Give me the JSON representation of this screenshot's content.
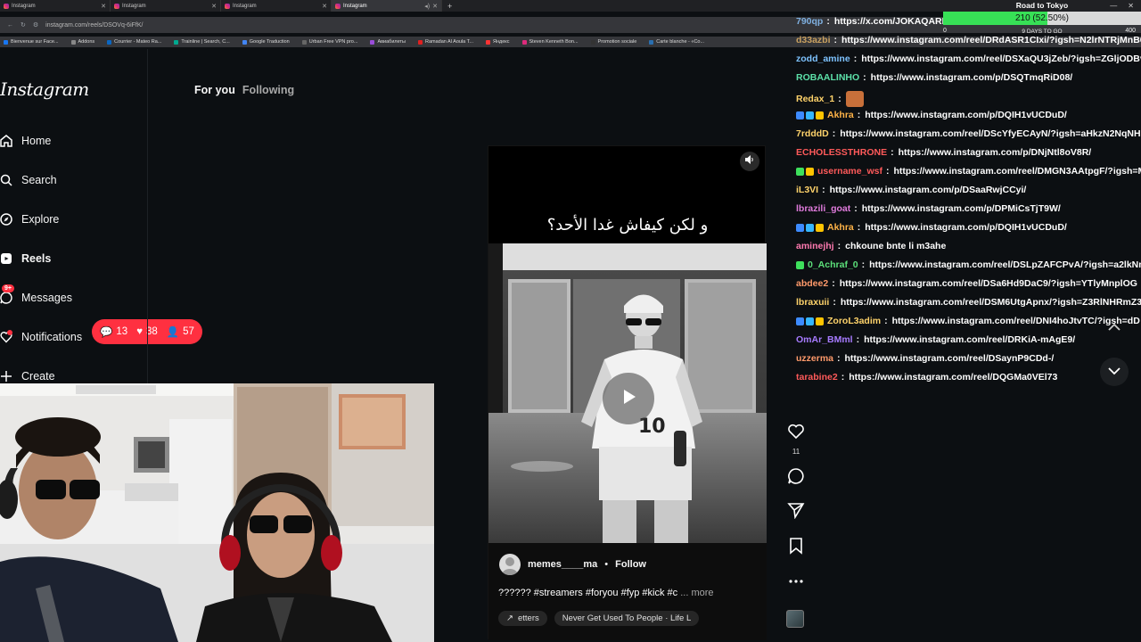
{
  "browser": {
    "tabs": [
      {
        "title": "Instagram",
        "active": false
      },
      {
        "title": "Instagram",
        "active": false
      },
      {
        "title": "Instagram",
        "active": false
      },
      {
        "title": "Instagram",
        "active": true
      }
    ],
    "new_tab": "+",
    "url": "instagram.com/reels/DSOVq-6iFfK/",
    "bookmarks": [
      {
        "label": "Bienvenue sur Face...",
        "color": "#1877f2"
      },
      {
        "label": "Addons",
        "color": "#888888"
      },
      {
        "label": "Courrier - Mateo Ra...",
        "color": "#0a66c2"
      },
      {
        "label": "Trainline | Search, C...",
        "color": "#00a88f"
      },
      {
        "label": "Google Traduction",
        "color": "#4285f4"
      },
      {
        "label": "Urban Free VPN pro...",
        "color": "#666666"
      },
      {
        "label": "Авиабилеты",
        "color": "#9a4dd9"
      },
      {
        "label": "Ramadan Al Aoula T...",
        "color": "#e02020"
      },
      {
        "label": "Яндекс",
        "color": "#ff3333"
      },
      {
        "label": "Steven Kenneth Bon...",
        "color": "#dd2a7b"
      },
      {
        "label": "Promotion sociale",
        "color": "#333333"
      },
      {
        "label": "Carte blanche - «Co...",
        "color": "#2a6fb0"
      }
    ]
  },
  "instagram": {
    "logo": "Instagram",
    "nav": {
      "home": "Home",
      "search": "Search",
      "explore": "Explore",
      "reels": "Reels",
      "messages": "Messages",
      "messages_badge": "9+",
      "notifications": "Notifications",
      "create": "Create"
    },
    "notif_pill": {
      "comments": "13",
      "likes": "38",
      "follows": "57"
    },
    "feed_tabs": {
      "for_you": "For you",
      "following": "Following"
    },
    "reel": {
      "caption_overlay": "و لكن كيفاش غدا الأحد؟",
      "author": "memes____ma",
      "separator": "•",
      "follow": "Follow",
      "caption": "?????? #streamers #foryou #fyp #kick #c",
      "more": "... more",
      "audio_left": "etters",
      "audio_track": "Never Get Used To People · Life L",
      "likes_count": "11"
    }
  },
  "chat": {
    "messages": [
      {
        "user": "790qp",
        "color": "#7fb0e0",
        "text": "https://x.com/JOKAQARM...",
        "icons": []
      },
      {
        "user": "d33azbi",
        "color": "#c8a060",
        "text": "https://www.instagram.com/reel/DRdASR1CIxi/?igsh=N2lrNTRjMnB6",
        "icons": []
      },
      {
        "user": "zodd_amine",
        "color": "#7ec3ff",
        "text": "https://www.instagram.com/reel/DSXaQU3jZeb/?igsh=ZGljODBv",
        "icons": []
      },
      {
        "user": "ROBAALINHO",
        "color": "#5ce0a8",
        "text": "https://www.instagram.com/p/DSQTmqRiD08/",
        "icons": []
      },
      {
        "user": "Redax_1",
        "color": "#ffd36b",
        "text": "",
        "icons": [],
        "emote": true
      },
      {
        "user": "Akhra",
        "color": "#ffb347",
        "text": "https://www.instagram.com/p/DQIH1vUCDuD/",
        "icons": [
          "#3d8bff",
          "#36b6ff",
          "#ffc400"
        ]
      },
      {
        "user": "7rdddD",
        "color": "#ffd36b",
        "text": "https://www.instagram.com/reel/DScYfyECAyN/?igsh=aHkzN2NqNH",
        "icons": []
      },
      {
        "user": "ECHOLESSTHRONE",
        "color": "#ff5a5a",
        "text": "https://www.instagram.com/p/DNjNtl8oV8R/",
        "icons": []
      },
      {
        "user": "username_wsf",
        "color": "#ff5a5a",
        "text": "https://www.instagram.com/reel/DMGN3AAtpgF/?igsh=M",
        "icons": [
          "#3ee05c",
          "#ffc400"
        ]
      },
      {
        "user": "iL3VI",
        "color": "#ffd36b",
        "text": "https://www.instagram.com/p/DSaaRwjCCyi/",
        "icons": []
      },
      {
        "user": "lbrazili_goat",
        "color": "#e07bdc",
        "text": "https://www.instagram.com/p/DPMiCsTjT9W/",
        "icons": []
      },
      {
        "user": "Akhra",
        "color": "#ffb347",
        "text": "https://www.instagram.com/p/DQIH1vUCDuD/",
        "icons": [
          "#3d8bff",
          "#36b6ff",
          "#ffc400"
        ]
      },
      {
        "user": "aminejhj",
        "color": "#ff7ab0",
        "text": "chkoune bnte li m3ahe",
        "icons": []
      },
      {
        "user": "0_Achraf_0",
        "color": "#5ce07a",
        "text": "https://www.instagram.com/reel/DSLpZAFCPvA/?igsh=a2lkNm",
        "icons": [
          "#3ee05c"
        ]
      },
      {
        "user": "abdee2",
        "color": "#ff9a6b",
        "text": "https://www.instagram.com/reel/DSa6Hd9DaC9/?igsh=YTlyMnplOG",
        "icons": []
      },
      {
        "user": "lbraxuii",
        "color": "#ffd36b",
        "text": "https://www.instagram.com/reel/DSM6UtgApnx/?igsh=Z3RlNHRmZ3",
        "icons": []
      },
      {
        "user": "ZoroL3adim",
        "color": "#ffd36b",
        "text": "https://www.instagram.com/reel/DNI4hoJtvTC/?igsh=dD",
        "icons": [
          "#3d8bff",
          "#36b6ff",
          "#ffc400"
        ]
      },
      {
        "user": "OmAr_BMml",
        "color": "#a77bff",
        "text": "https://www.instagram.com/reel/DRKiA-mAgE9/",
        "icons": []
      },
      {
        "user": "uzzerma",
        "color": "#ff9a6b",
        "text": "https://www.instagram.com/reel/DSaynP9CDd-/",
        "icons": []
      },
      {
        "user": "tarabine2",
        "color": "#ff5a5a",
        "text": "https://www.instagram.com/reel/DQGMa0VEl73",
        "icons": []
      }
    ],
    "separator": ":"
  },
  "goal": {
    "title": "Road to Tokyo",
    "progress_text": "210 (52.50%)",
    "progress_fraction": 0.525,
    "min": "0",
    "max": "400",
    "days": "9 DAYS TO GO",
    "bar_color": "#37e056"
  },
  "colors": {
    "instagram_red": "#ff3040",
    "background": "#0c0f12"
  }
}
